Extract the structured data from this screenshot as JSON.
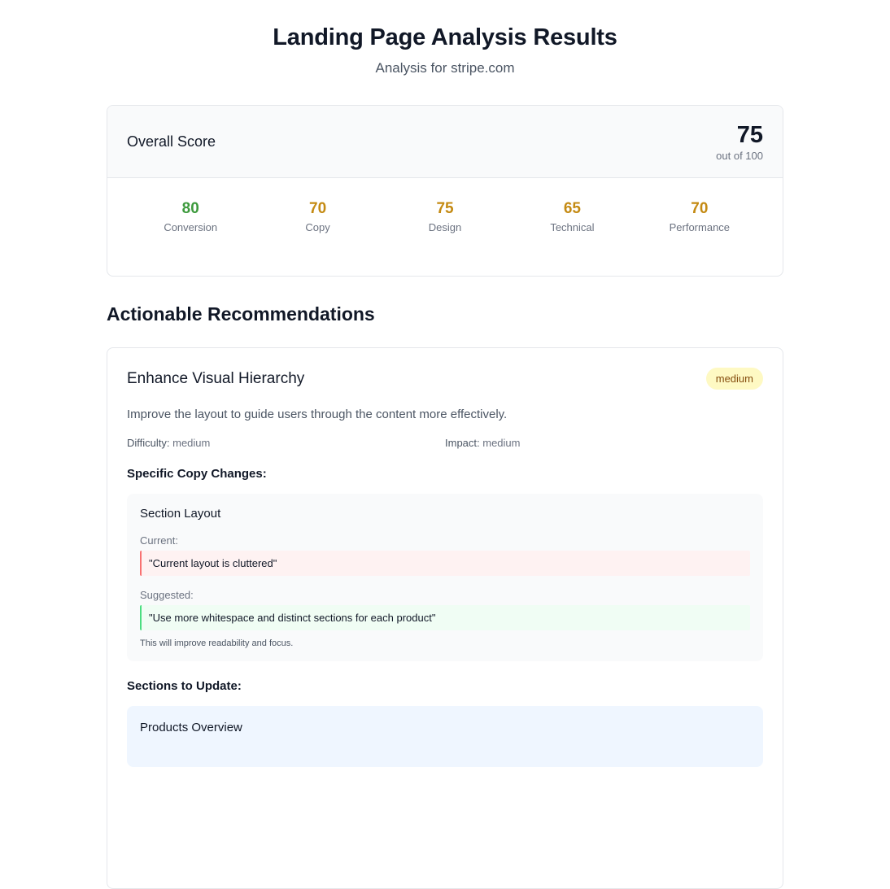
{
  "header": {
    "title": "Landing Page Analysis Results",
    "subtitle": "Analysis for stripe.com"
  },
  "overall": {
    "label": "Overall Score",
    "score": "75",
    "out_of": "out of 100"
  },
  "metrics": [
    {
      "value": "80",
      "label": "Conversion",
      "color": "#3d9a3d"
    },
    {
      "value": "70",
      "label": "Copy",
      "color": "#c48a12"
    },
    {
      "value": "75",
      "label": "Design",
      "color": "#c48a12"
    },
    {
      "value": "65",
      "label": "Technical",
      "color": "#c48a12"
    },
    {
      "value": "70",
      "label": "Performance",
      "color": "#c48a12"
    }
  ],
  "recommendations_title": "Actionable Recommendations",
  "recommendation": {
    "title": "Enhance Visual Hierarchy",
    "priority": "medium",
    "description": "Improve the layout to guide users through the content more effectively.",
    "difficulty_label": "Difficulty:",
    "difficulty": "medium",
    "impact_label": "Impact:",
    "impact": "medium",
    "copy_changes_heading": "Specific Copy Changes:",
    "copy_change": {
      "title": "Section Layout",
      "current_label": "Current:",
      "current": "\"Current layout is cluttered\"",
      "suggested_label": "Suggested:",
      "suggested": "\"Use more whitespace and distinct sections for each product\"",
      "note": "This will improve readability and focus."
    },
    "sections_heading": "Sections to Update:",
    "section": {
      "title": "Products Overview"
    }
  }
}
